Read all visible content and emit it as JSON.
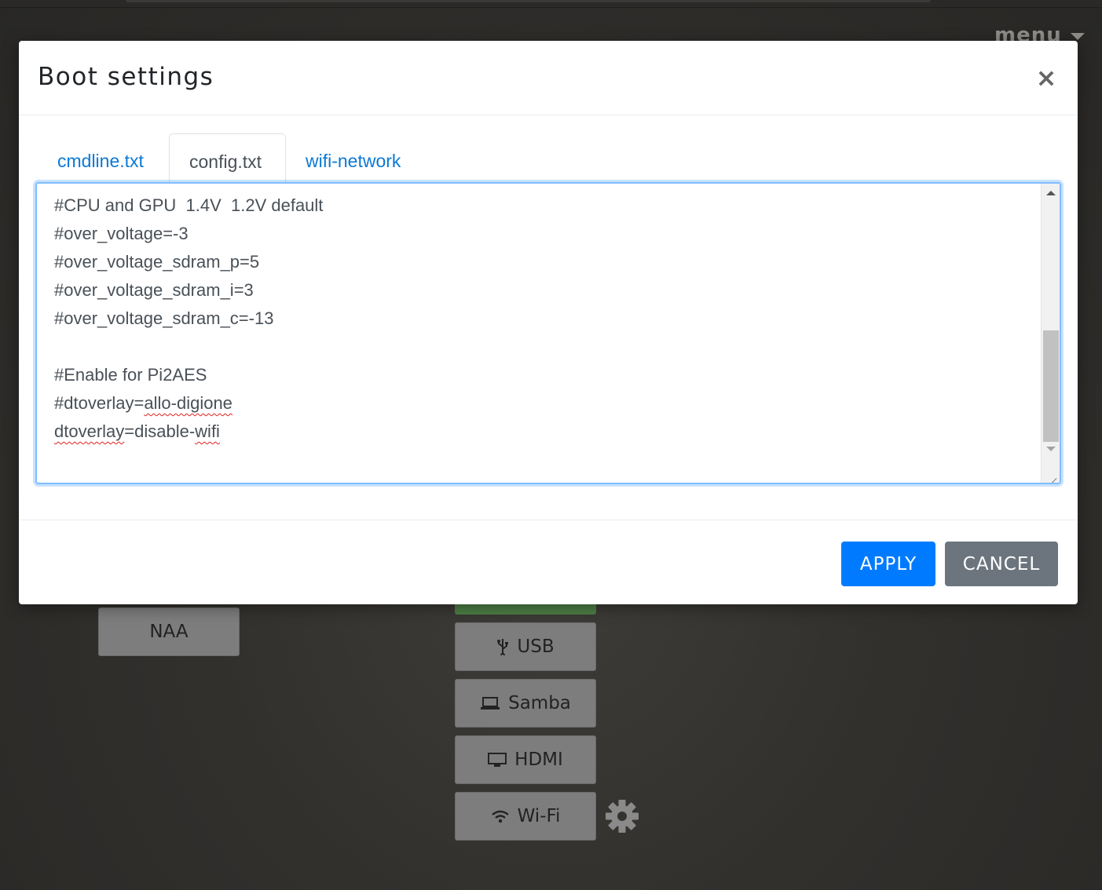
{
  "background": {
    "menu_label": "menu",
    "buttons": {
      "naa": {
        "label": "NAA",
        "icon": ""
      },
      "usb": {
        "label": "USB",
        "icon": "usb-icon"
      },
      "samba": {
        "label": "Samba",
        "icon": "laptop-icon"
      },
      "hdmi": {
        "label": "HDMI",
        "icon": "monitor-icon"
      },
      "wifi": {
        "label": "Wi-Fi",
        "icon": "wifi-icon"
      }
    },
    "settings_icon": "gear-icon",
    "active_indicator_color": "#4d7f45"
  },
  "modal": {
    "title": "Boot settings",
    "close_label": "×",
    "tabs": [
      {
        "label": "cmdline.txt",
        "active": false
      },
      {
        "label": "config.txt",
        "active": true
      },
      {
        "label": "wifi-network",
        "active": false
      }
    ],
    "editor_lines": [
      "#CPU and GPU  1.4V  1.2V default",
      "#over_voltage=-3",
      "#over_voltage_sdram_p=5",
      "#over_voltage_sdram_i=3",
      "#over_voltage_sdram_c=-13",
      "",
      "#Enable for Pi2AES",
      "#dtoverlay=allo-digione",
      "dtoverlay=disable-wifi"
    ],
    "apply_label": "APPLY",
    "cancel_label": "CANCEL",
    "colors": {
      "primary": "#007bff",
      "secondary": "#6c757d",
      "link": "#0a79d6"
    }
  }
}
